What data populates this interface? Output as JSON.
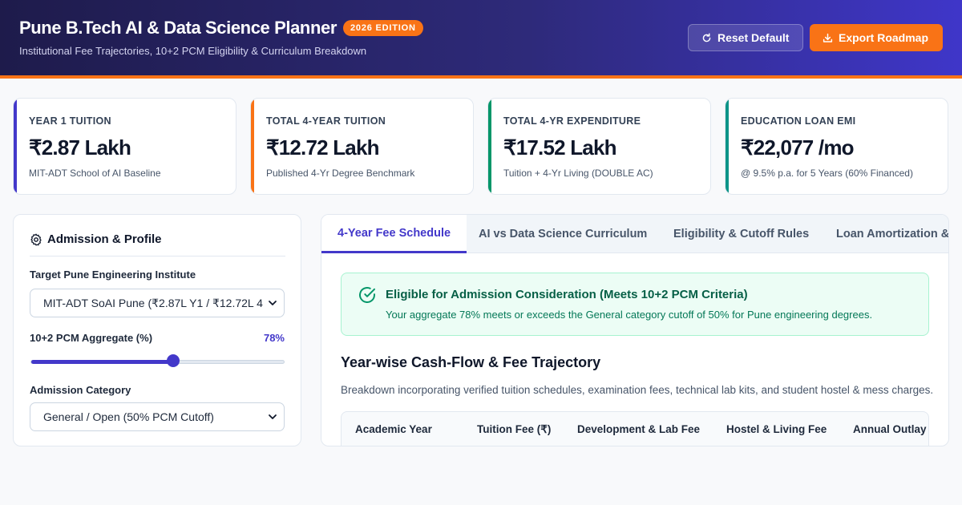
{
  "header": {
    "title": "Pune B.Tech AI & Data Science Planner",
    "badge": "2026 EDITION",
    "subtitle": "Institutional Fee Trajectories, 10+2 PCM Eligibility & Curriculum Breakdown",
    "reset_label": "Reset Default",
    "export_label": "Export Roadmap",
    "colors": {
      "primary": "#4338ca",
      "accent": "#f97316"
    }
  },
  "stats": [
    {
      "label": "YEAR 1 TUITION",
      "value": "₹2.87 Lakh",
      "note": "MIT-ADT School of AI Baseline",
      "color": "#4338ca"
    },
    {
      "label": "TOTAL 4-YEAR TUITION",
      "value": "₹12.72 Lakh",
      "note": "Published 4-Yr Degree Benchmark",
      "color": "#f97316"
    },
    {
      "label": "TOTAL 4-YR EXPENDITURE",
      "value": "₹17.52 Lakh",
      "note": "Tuition + 4-Yr Living (DOUBLE AC)",
      "color": "#059669"
    },
    {
      "label": "EDUCATION LOAN EMI",
      "value": "₹22,077 /mo",
      "note": "@ 9.5% p.a. for 5 Years (60% Financed)",
      "color": "#0d9488"
    }
  ],
  "profile": {
    "title": "Admission & Profile",
    "institute_label": "Target Pune Engineering Institute",
    "institute_value": "MIT-ADT SoAI Pune (₹2.87L Y1 / ₹12.72L 4",
    "pcm_label": "10+2 PCM Aggregate (%)",
    "pcm_display": "78%",
    "pcm_value": 78,
    "pcm_min": 50,
    "pcm_max": 100,
    "category_label": "Admission Category",
    "category_value": "General / Open (50% PCM Cutoff)"
  },
  "tabs": [
    {
      "label": "4-Year Fee Schedule",
      "active": true
    },
    {
      "label": "AI vs Data Science Curriculum",
      "active": false
    },
    {
      "label": "Eligibility & Cutoff Rules",
      "active": false
    },
    {
      "label": "Loan Amortization &",
      "active": false
    }
  ],
  "eligibility": {
    "title": "Eligible for Admission Consideration (Meets 10+2 PCM Criteria)",
    "body": "Your aggregate 78% meets or exceeds the General category cutoff of 50% for Pune engineering degrees."
  },
  "schedule": {
    "title": "Year-wise Cash-Flow & Fee Trajectory",
    "description": "Breakdown incorporating verified tuition schedules, examination fees, technical lab kits, and student hostel & mess charges.",
    "columns": [
      "Academic Year",
      "Tuition Fee (₹)",
      "Development & Lab Fee",
      "Hostel & Living Fee",
      "Annual Outlay"
    ]
  }
}
